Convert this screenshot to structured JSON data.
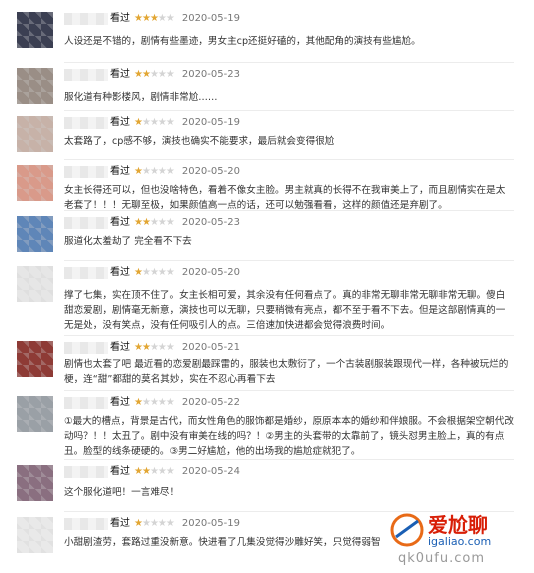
{
  "reviews": [
    {
      "seen": "看过",
      "stars": 3,
      "date": "2020-05-19",
      "text": "人设还是不错的，剧情有些墨迹，男女主cp还挺好磕的，其他配角的演技有些尴尬。",
      "avatar_color": "#3b3f52"
    },
    {
      "seen": "看过",
      "stars": 2,
      "date": "2020-05-23",
      "text": "服化道有种影楼风，剧情非常尬……",
      "avatar_color": "#9a8e86"
    },
    {
      "seen": "看过",
      "stars": 1,
      "date": "2020-05-19",
      "text": "太套路了，cp感不够，演技也确实不能要求，最后就会变得很尬",
      "avatar_color": "#c7b2a8"
    },
    {
      "seen": "看过",
      "stars": 1,
      "date": "2020-05-20",
      "text": "女主长得还可以，但也没啥特色，看着不像女主脸。男主就真的长得不在我审美上了，而且剧情实在是太老套了！！！无聊至极，如果颜值高一点的话，还可以勉强看看，这样的颜值还是弃剧了。",
      "avatar_color": "#d99a8a"
    },
    {
      "seen": "看过",
      "stars": 2,
      "date": "2020-05-23",
      "text": "服道化太羞劫了 完全看不下去",
      "avatar_color": "#5f86b8"
    },
    {
      "seen": "看过",
      "stars": 1,
      "date": "2020-05-20",
      "text": "撑了七集，实在顶不住了。女主长相可爱，其余没有任何看点了。真的非常无聊非常无聊非常无聊。傻白甜恋爱剧，剧情毫无新意，演技也可以无聊，只要稍微有亮点，都不至于看不下去。但是这部剧情真的一无是处，没有笑点，没有任何吸引人的点。三倍速加快进都会觉得浪费时间。",
      "avatar_color": "#e6e6e6"
    },
    {
      "seen": "看过",
      "stars": 2,
      "date": "2020-05-21",
      "text": "剧情也太套了吧 最近看的恋爱剧最踩雷的，服装也太敷衍了，一个古装剧服装跟现代一样，各种被玩烂的梗，连“甜”都甜的莫名其妙，实在不忍心再看下去",
      "avatar_color": "#8e3b36"
    },
    {
      "seen": "看过",
      "stars": 1,
      "date": "2020-05-22",
      "text": "①最大的槽点，背景是古代，而女性角色的服饰都是婚纱，原原本本的婚纱和伴娘服。不会根据架空朝代改动吗？！！太丑了。剧中没有审美在线的吗？！②男主的头套带的太靠前了，镜头怼男主脸上，真的有点丑。脸型的线条硬硬的。③男二好尴尬，他的出场我的尴尬症就犯了。",
      "avatar_color": "#9aa0a6"
    },
    {
      "seen": "看过",
      "stars": 2,
      "date": "2020-05-24",
      "text": "这个服化道吧！一言难尽！",
      "avatar_color": "#8a6f80"
    },
    {
      "seen": "看过",
      "stars": 1,
      "date": "2020-05-19",
      "text": "小甜剧渣劳，套路过重没新意。快进看了几集没觉得沙雕好笑，只觉得弱智",
      "avatar_color": "#e9e9e9"
    }
  ],
  "watermark": {
    "brand_text": "爱尬聊",
    "url_text": "igaliao.com",
    "bottom_text": "qk0ufu.com"
  }
}
